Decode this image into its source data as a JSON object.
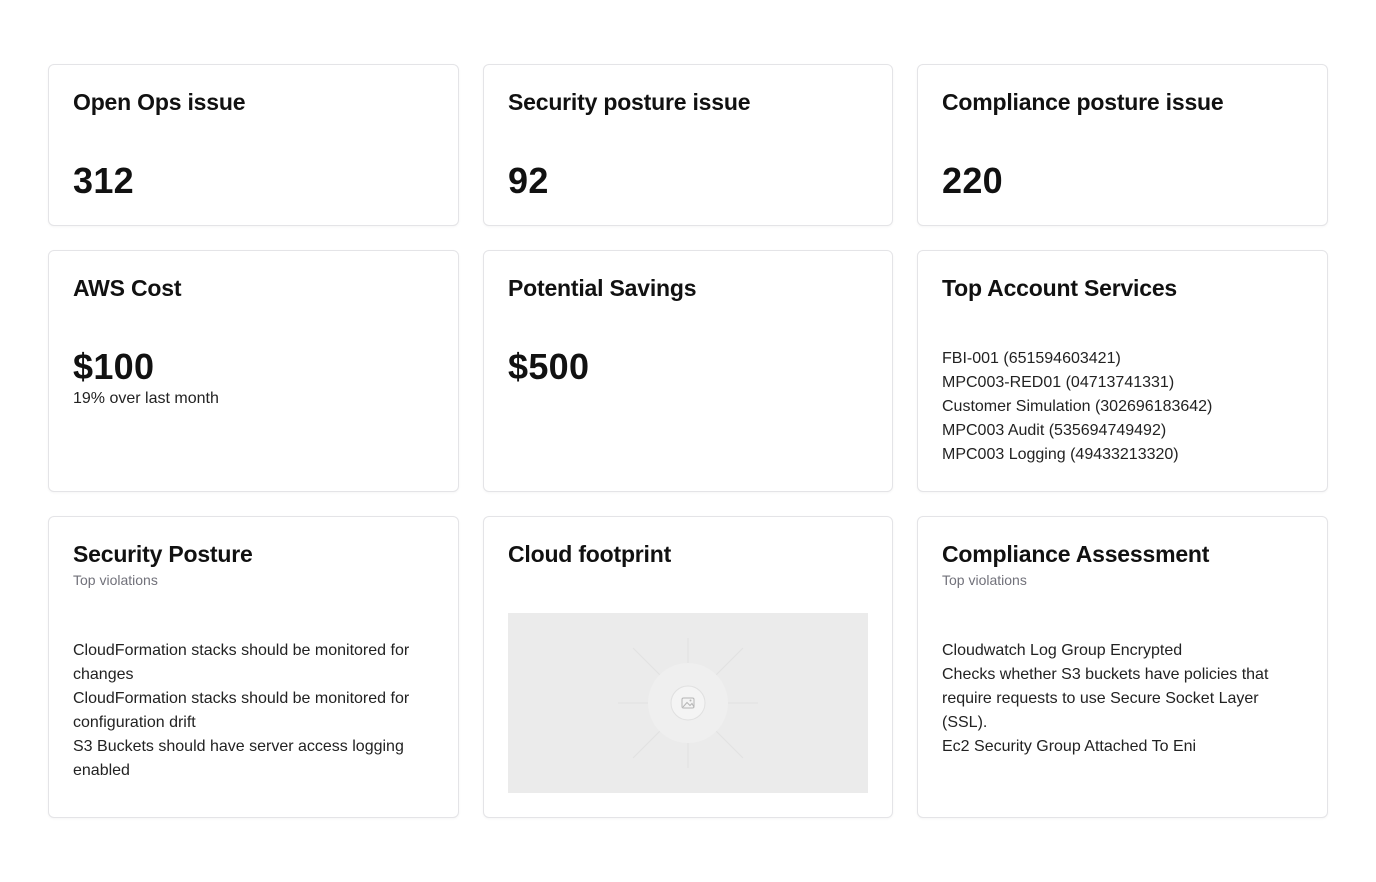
{
  "kpis": {
    "ops": {
      "title": "Open Ops issue",
      "value": "312"
    },
    "security": {
      "title": "Security posture issue",
      "value": "92"
    },
    "compliance": {
      "title": "Compliance posture issue",
      "value": "220"
    }
  },
  "cost": {
    "title": "AWS Cost",
    "value": "$100",
    "note": "19% over last month"
  },
  "savings": {
    "title": "Potential Savings",
    "value": "$500"
  },
  "top_accounts": {
    "title": "Top Account Services",
    "items": [
      "FBI-001 (651594603421)",
      "MPC003-RED01 (04713741331)",
      "Customer Simulation (302696183642)",
      "MPC003 Audit (535694749492)",
      "MPC003 Logging (49433213320)"
    ]
  },
  "security_posture": {
    "title": "Security Posture",
    "subtitle": "Top violations",
    "items": [
      "CloudFormation stacks should be monitored for changes",
      "CloudFormation stacks should be monitored for configuration drift",
      "S3 Buckets should have server access logging enabled"
    ]
  },
  "cloud_footprint": {
    "title": "Cloud footprint",
    "icon": "image-placeholder-icon"
  },
  "compliance_assessment": {
    "title": "Compliance Assessment",
    "subtitle": "Top violations",
    "items": [
      "Cloudwatch Log Group Encrypted",
      "Checks whether S3 buckets have policies that require requests to use Secure Socket Layer (SSL).",
      "Ec2 Security Group Attached To Eni"
    ]
  },
  "colors": {
    "card_border": "#e4e4e7",
    "placeholder_bg": "#ebebeb",
    "muted_text": "#71717a"
  }
}
